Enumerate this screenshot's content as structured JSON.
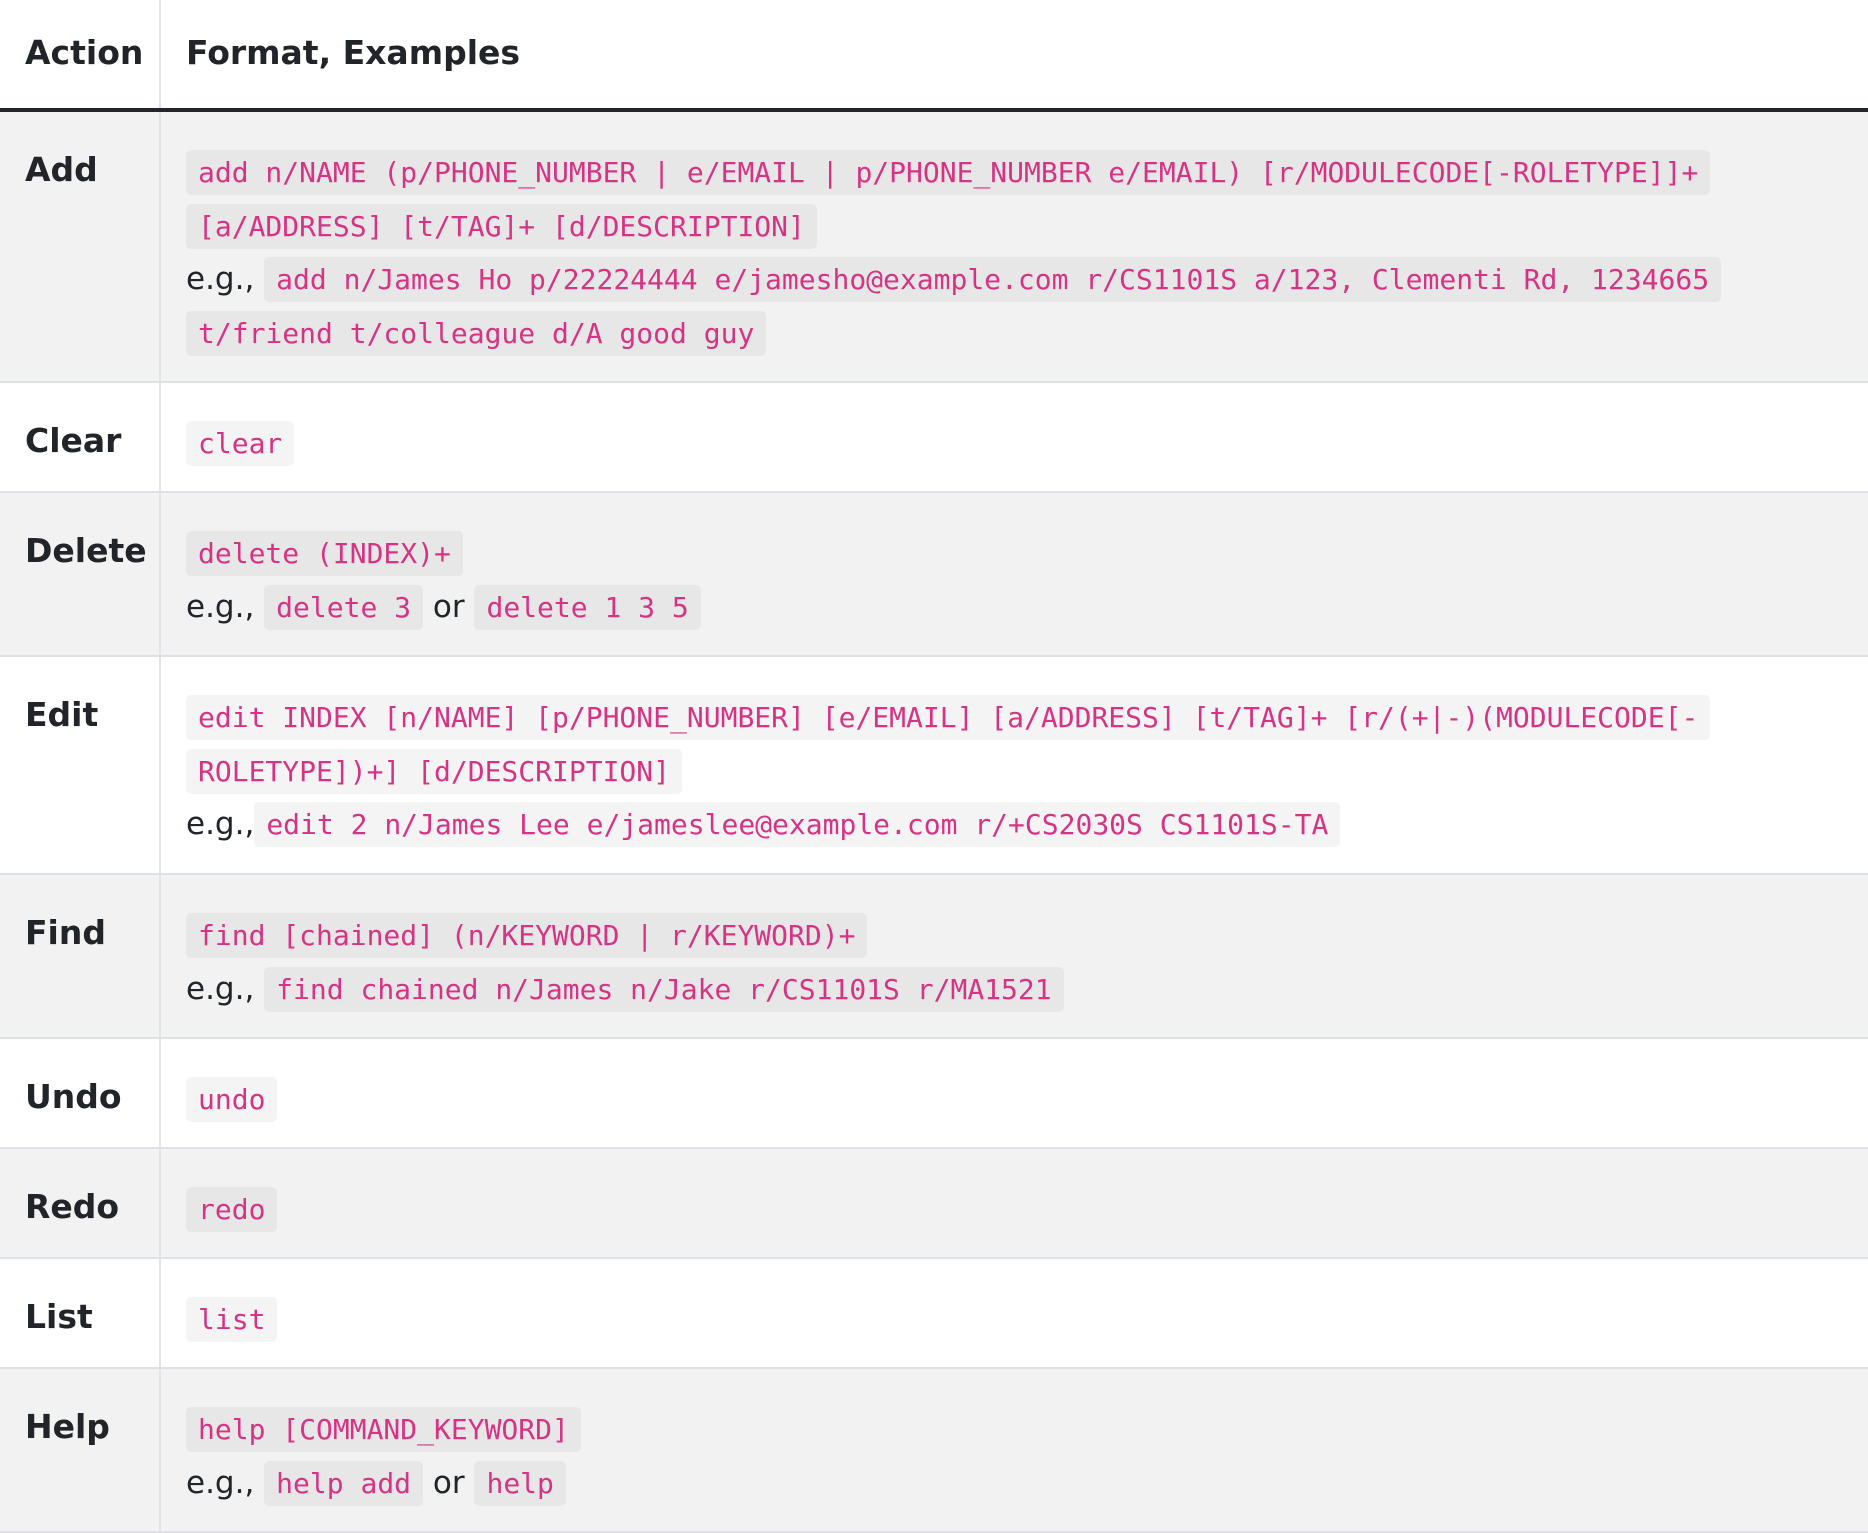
{
  "header": {
    "action": "Action",
    "format": "Format, Examples"
  },
  "rows": [
    {
      "action": "Add",
      "format": "add n/NAME (p/PHONE_NUMBER | e/EMAIL | p/PHONE_NUMBER e/EMAIL) [r/MODULECODE[-ROLETYPE]]+ [a/ADDRESS] [t/TAG]+ [d/DESCRIPTION]",
      "eg_prefix": "e.g.,",
      "example_1": "add n/James Ho p/22224444 e/jamesho@example.com r/CS1101S a/123, Clementi Rd, 1234665 t/friend t/colleague d/A good guy"
    },
    {
      "action": "Clear",
      "format": "clear"
    },
    {
      "action": "Delete",
      "format": "delete (INDEX)+",
      "eg_prefix": "e.g.,",
      "example_1": "delete 3",
      "joiner": "or",
      "example_2": "delete 1 3 5"
    },
    {
      "action": "Edit",
      "format": "edit INDEX [n/NAME] [p/PHONE_NUMBER] [e/EMAIL] [a/ADDRESS] [t/TAG]+ [r/(+|-)(MODULECODE[-ROLETYPE])+] [d/DESCRIPTION]",
      "eg_prefix": "e.g.,",
      "example_1": "edit 2 n/James Lee e/jameslee@example.com r/+CS2030S CS1101S-TA"
    },
    {
      "action": "Find",
      "format": "find [chained] (n/KEYWORD | r/KEYWORD)+",
      "eg_prefix": "e.g.,",
      "example_1": "find chained n/James n/Jake r/CS1101S r/MA1521"
    },
    {
      "action": "Undo",
      "format": "undo"
    },
    {
      "action": "Redo",
      "format": "redo"
    },
    {
      "action": "List",
      "format": "list"
    },
    {
      "action": "Help",
      "format": "help [COMMAND_KEYWORD]",
      "eg_prefix": "e.g.,",
      "example_1": "help add",
      "joiner": "or",
      "example_2": "help"
    }
  ],
  "colors": {
    "code_text": "#d63384",
    "body_text": "#212529",
    "alt_row": "#f2f2f2"
  }
}
